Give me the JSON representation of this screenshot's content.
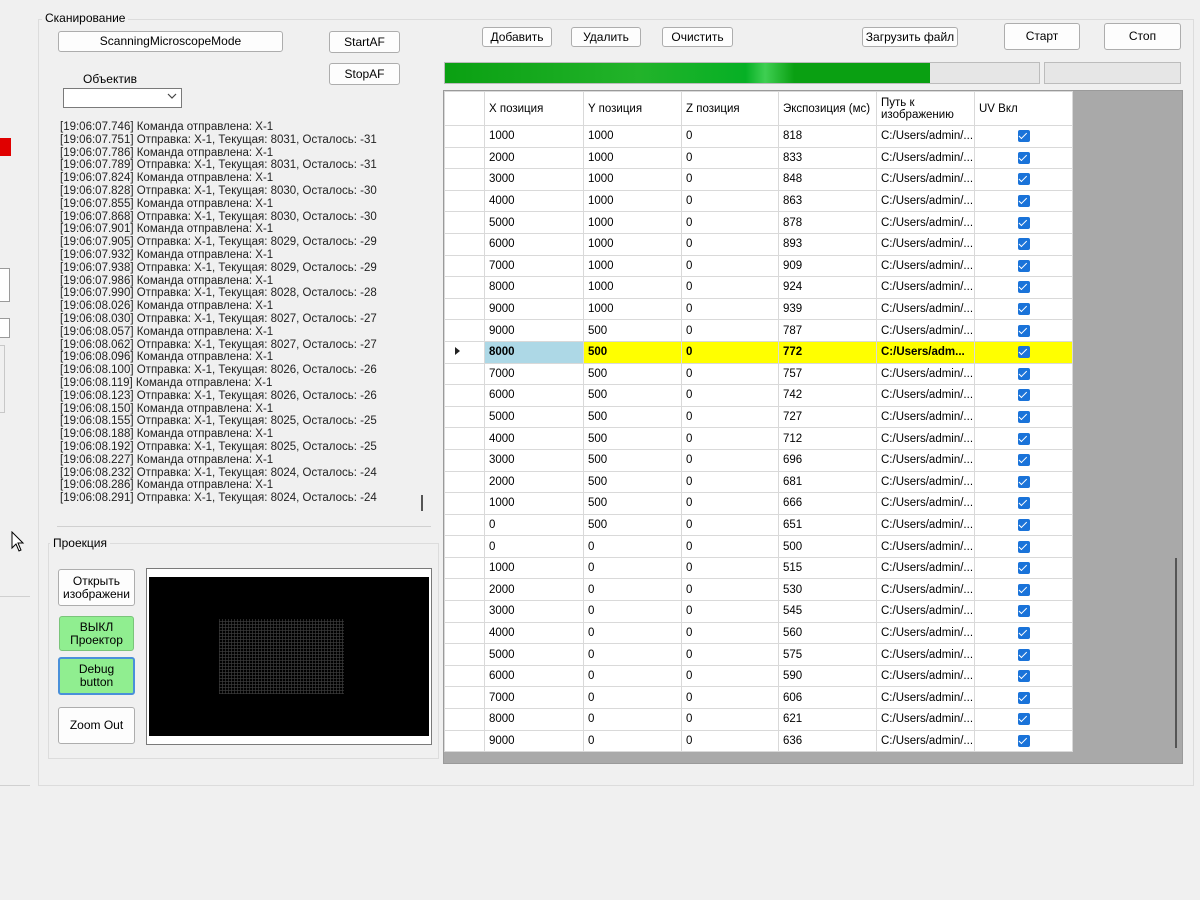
{
  "scan_group": {
    "title": "Сканирование"
  },
  "buttons": {
    "mode": "ScanningMicroscopeMode",
    "start_af": "StartAF",
    "stop_af": "StopAF",
    "add": "Добавить",
    "delete": "Удалить",
    "clear": "Очистить",
    "load_file": "Загрузить файл",
    "start": "Старт",
    "stop": "Стоп",
    "open_image": "Открыть изображени",
    "projector_off": "ВЫКЛ Проектор",
    "debug": "Debug button",
    "zoom_out": "Zoom Out"
  },
  "objective": {
    "label": "Объектив",
    "value": ""
  },
  "projection_group": {
    "title": "Проекция"
  },
  "progress": {
    "fraction": 0.816
  },
  "log": [
    "[19:06:07.746] Команда отправлена: X-1",
    "[19:06:07.751] Отправка: X-1, Текущая: 8031, Осталось: -31",
    "[19:06:07.786] Команда отправлена: X-1",
    "[19:06:07.789] Отправка: X-1, Текущая: 8031, Осталось: -31",
    "[19:06:07.824] Команда отправлена: X-1",
    "[19:06:07.828] Отправка: X-1, Текущая: 8030, Осталось: -30",
    "[19:06:07.855] Команда отправлена: X-1",
    "[19:06:07.868] Отправка: X-1, Текущая: 8030, Осталось: -30",
    "[19:06:07.901] Команда отправлена: X-1",
    "[19:06:07.905] Отправка: X-1, Текущая: 8029, Осталось: -29",
    "[19:06:07.932] Команда отправлена: X-1",
    "[19:06:07.938] Отправка: X-1, Текущая: 8029, Осталось: -29",
    "[19:06:07.986] Команда отправлена: X-1",
    "[19:06:07.990] Отправка: X-1, Текущая: 8028, Осталось: -28",
    "[19:06:08.026] Команда отправлена: X-1",
    "[19:06:08.030] Отправка: X-1, Текущая: 8027, Осталось: -27",
    "[19:06:08.057] Команда отправлена: X-1",
    "[19:06:08.062] Отправка: X-1, Текущая: 8027, Осталось: -27",
    "[19:06:08.096] Команда отправлена: X-1",
    "[19:06:08.100] Отправка: X-1, Текущая: 8026, Осталось: -26",
    "[19:06:08.119] Команда отправлена: X-1",
    "[19:06:08.123] Отправка: X-1, Текущая: 8026, Осталось: -26",
    "[19:06:08.150] Команда отправлена: X-1",
    "[19:06:08.155] Отправка: X-1, Текущая: 8025, Осталось: -25",
    "[19:06:08.188] Команда отправлена: X-1",
    "[19:06:08.192] Отправка: X-1, Текущая: 8025, Осталось: -25",
    "[19:06:08.227] Команда отправлена: X-1",
    "[19:06:08.232] Отправка: X-1, Текущая: 8024, Осталось: -24",
    "[19:06:08.286] Команда отправлена: X-1",
    "[19:06:08.291] Отправка: X-1, Текущая: 8024, Осталось: -24"
  ],
  "grid": {
    "columns": [
      "X позиция",
      "Y позиция",
      "Z позиция",
      "Экспозиция (мс)",
      "Путь к изображению",
      "UV Вкл"
    ],
    "selected_index": 10,
    "rows": [
      [
        "1000",
        "1000",
        "0",
        "818",
        "C:/Users/admin/...",
        true
      ],
      [
        "2000",
        "1000",
        "0",
        "833",
        "C:/Users/admin/...",
        true
      ],
      [
        "3000",
        "1000",
        "0",
        "848",
        "C:/Users/admin/...",
        true
      ],
      [
        "4000",
        "1000",
        "0",
        "863",
        "C:/Users/admin/...",
        true
      ],
      [
        "5000",
        "1000",
        "0",
        "878",
        "C:/Users/admin/...",
        true
      ],
      [
        "6000",
        "1000",
        "0",
        "893",
        "C:/Users/admin/...",
        true
      ],
      [
        "7000",
        "1000",
        "0",
        "909",
        "C:/Users/admin/...",
        true
      ],
      [
        "8000",
        "1000",
        "0",
        "924",
        "C:/Users/admin/...",
        true
      ],
      [
        "9000",
        "1000",
        "0",
        "939",
        "C:/Users/admin/...",
        true
      ],
      [
        "9000",
        "500",
        "0",
        "787",
        "C:/Users/admin/...",
        true
      ],
      [
        "8000",
        "500",
        "0",
        "772",
        "C:/Users/adm...",
        true
      ],
      [
        "7000",
        "500",
        "0",
        "757",
        "C:/Users/admin/...",
        true
      ],
      [
        "6000",
        "500",
        "0",
        "742",
        "C:/Users/admin/...",
        true
      ],
      [
        "5000",
        "500",
        "0",
        "727",
        "C:/Users/admin/...",
        true
      ],
      [
        "4000",
        "500",
        "0",
        "712",
        "C:/Users/admin/...",
        true
      ],
      [
        "3000",
        "500",
        "0",
        "696",
        "C:/Users/admin/...",
        true
      ],
      [
        "2000",
        "500",
        "0",
        "681",
        "C:/Users/admin/...",
        true
      ],
      [
        "1000",
        "500",
        "0",
        "666",
        "C:/Users/admin/...",
        true
      ],
      [
        "0",
        "500",
        "0",
        "651",
        "C:/Users/admin/...",
        true
      ],
      [
        "0",
        "0",
        "0",
        "500",
        "C:/Users/admin/...",
        true
      ],
      [
        "1000",
        "0",
        "0",
        "515",
        "C:/Users/admin/...",
        true
      ],
      [
        "2000",
        "0",
        "0",
        "530",
        "C:/Users/admin/...",
        true
      ],
      [
        "3000",
        "0",
        "0",
        "545",
        "C:/Users/admin/...",
        true
      ],
      [
        "4000",
        "0",
        "0",
        "560",
        "C:/Users/admin/...",
        true
      ],
      [
        "5000",
        "0",
        "0",
        "575",
        "C:/Users/admin/...",
        true
      ],
      [
        "6000",
        "0",
        "0",
        "590",
        "C:/Users/admin/...",
        true
      ],
      [
        "7000",
        "0",
        "0",
        "606",
        "C:/Users/admin/...",
        true
      ],
      [
        "8000",
        "0",
        "0",
        "621",
        "C:/Users/admin/...",
        true
      ],
      [
        "9000",
        "0",
        "0",
        "636",
        "C:/Users/admin/...",
        true
      ]
    ]
  },
  "colors": {
    "selected_row": "#ffff00",
    "current_cell": "#add8e6",
    "progress": "#0aa012",
    "checkbox": "#1a73d9",
    "indicator": "#e00000"
  }
}
